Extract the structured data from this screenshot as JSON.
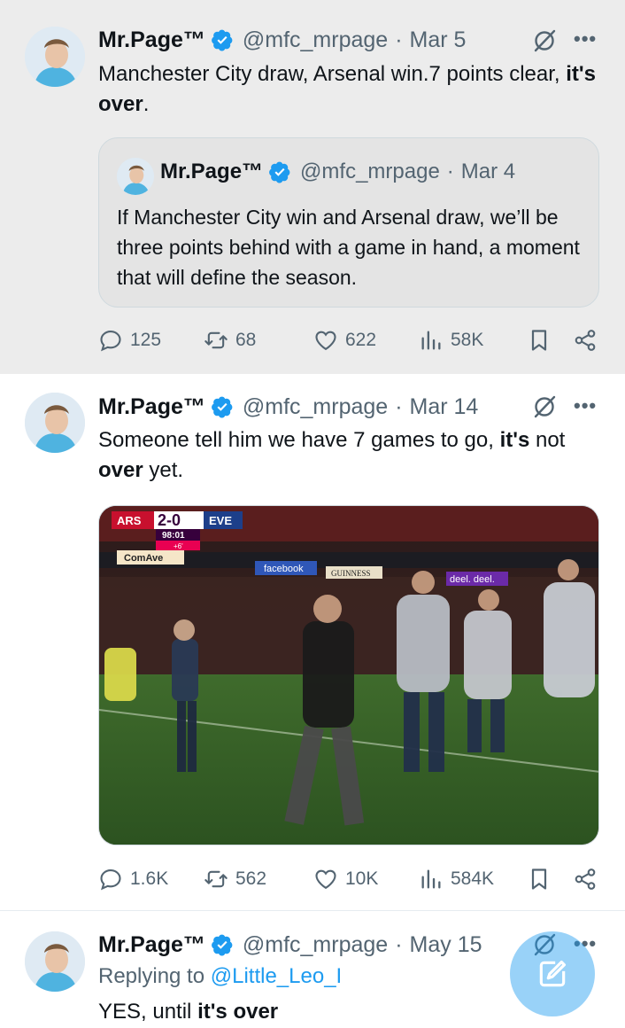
{
  "tweets": [
    {
      "author_name": "Mr.Page™",
      "handle": "@mfc_mrpage",
      "separator": "·",
      "date": "Mar 5",
      "text_part1": "Manchester City draw, Arsenal win.7 points clear, ",
      "text_bold": "it's over",
      "text_part2": ".",
      "quote": {
        "author_name": "Mr.Page™",
        "handle": "@mfc_mrpage",
        "date": "Mar 4",
        "text": "If Manchester City win and Arsenal draw, we’ll be three points behind with a game in hand, a moment that will define the season."
      },
      "stats": {
        "replies": "125",
        "reposts": "68",
        "likes": "622",
        "views": "58K"
      }
    },
    {
      "author_name": "Mr.Page™",
      "handle": "@mfc_mrpage",
      "separator": "·",
      "date": "Mar 14",
      "text_part1": "Someone tell him we have 7 games to go, ",
      "text_bold1": "it's",
      "text_part2": " not ",
      "text_bold2": "over",
      "text_part3": " yet.",
      "media": {
        "scorebug_home": "ARS",
        "scorebug_score": "2-0",
        "scorebug_away": "EVE",
        "scorebug_clock": "98:01",
        "scorebug_added": "+6'",
        "ad_board_1": "ComAve",
        "ad_board_2": "facebook",
        "ad_board_3": "GUINNESS",
        "ad_board_4": "deel. deel."
      },
      "stats": {
        "replies": "1.6K",
        "reposts": "562",
        "likes": "10K",
        "views": "584K"
      }
    },
    {
      "author_name": "Mr.Page™",
      "handle": "@mfc_mrpage",
      "separator": "·",
      "date": "May 15",
      "replying_label": "Replying to",
      "replying_mention": "@Little_Leo_I",
      "text_part1": "YES, until ",
      "text_bold": "it's over"
    }
  ],
  "icons": {
    "verified": "verified-badge-icon",
    "grok": "grok-icon",
    "more": "more-icon",
    "reply": "reply-icon",
    "repost": "repost-icon",
    "like": "heart-icon",
    "views": "views-icon",
    "bookmark": "bookmark-icon",
    "share": "share-icon",
    "compose": "compose-icon"
  },
  "more_glyph": "•••",
  "colors": {
    "verified_blue": "#1d9bf0",
    "muted": "#536471",
    "text": "#0f1419",
    "highlighted_bg": "#ececec"
  }
}
